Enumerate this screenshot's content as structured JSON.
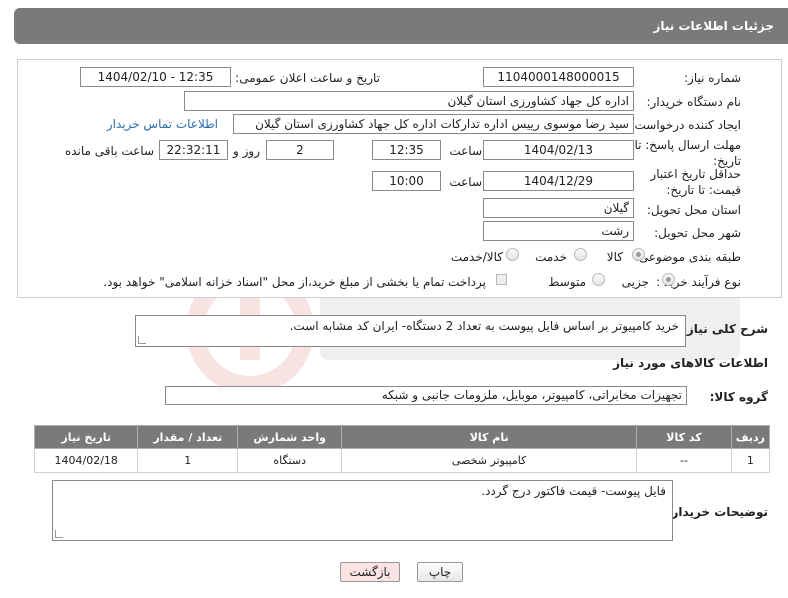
{
  "header": {
    "title": "جزئیات اطلاعات نیاز"
  },
  "fields": {
    "need_number_label": "شماره نیاز:",
    "need_number": "1104000148000015",
    "announce_label": "تاریخ و ساعت اعلان عمومی:",
    "announce_value": "1404/02/10 - 12:35",
    "buyer_org_label": "نام دستگاه خریدار:",
    "buyer_org": "اداره کل جهاد کشاورزی استان گیلان",
    "creator_label": "ایجاد کننده درخواست:",
    "creator": "سید رضا  موسوی رییس اداره  تدارکات اداره کل جهاد کشاورزی استان گیلان",
    "contact_link": "اطلاعات تماس خریدار",
    "deadline_label": "مهلت ارسال پاسخ: تا تاریخ:",
    "deadline_date": "1404/02/13",
    "time_label": "ساعت",
    "deadline_time": "12:35",
    "days_value": "2",
    "days_label": "روز و",
    "remaining_time": "22:32:11",
    "remaining_label": "ساعت باقی مانده",
    "validity_label": "حداقل تاریخ اعتبار قیمت: تا تاریخ:",
    "validity_date": "1404/12/29",
    "validity_time": "10:00",
    "province_label": "استان محل تحویل:",
    "province": "گیلان",
    "city_label": "شهر محل تحویل:",
    "city": "رشت",
    "category_label": "طبقه بندی موضوعی:",
    "category_options": [
      "کالا",
      "خدمت",
      "کالا/خدمت"
    ],
    "process_label": "نوع فرآیند خرید :",
    "process_options": [
      "جزیی",
      "متوسط"
    ],
    "payment_note": "پرداخت تمام یا بخشی از مبلغ خرید،از محل \"اسناد خزانه اسلامی\" خواهد بود."
  },
  "description": {
    "label": "شرح کلی نیاز:",
    "text": "خرید کامپیوتر بر اساس فایل پیوست به تعداد 2 دستگاه- ایران کد مشابه است."
  },
  "goods": {
    "section_title": "اطلاعات کالاهای مورد نیاز",
    "group_label": "گروه کالا:",
    "group_value": "تجهیزات مخابراتی، کامپیوتر، موبایل، ملزومات جانبی و شبکه",
    "columns": [
      "ردیف",
      "کد کالا",
      "نام کالا",
      "واحد شمارش",
      "تعداد / مقدار",
      "تاریخ نیاز"
    ],
    "rows": [
      [
        "1",
        "--",
        "کامپیوتر شخصی",
        "دستگاه",
        "1",
        "1404/02/18"
      ]
    ]
  },
  "buyer_notes": {
    "label": "توضیحات خریدار:",
    "text": "فایل پیوست- قیمت فاکتور درج گردد."
  },
  "buttons": {
    "print": "چاپ",
    "back": "بازگشت"
  },
  "colors": {
    "header_bg": "#7a7a7a",
    "link": "#2b6cb0",
    "back_btn_bg": "#f9e3e3"
  }
}
